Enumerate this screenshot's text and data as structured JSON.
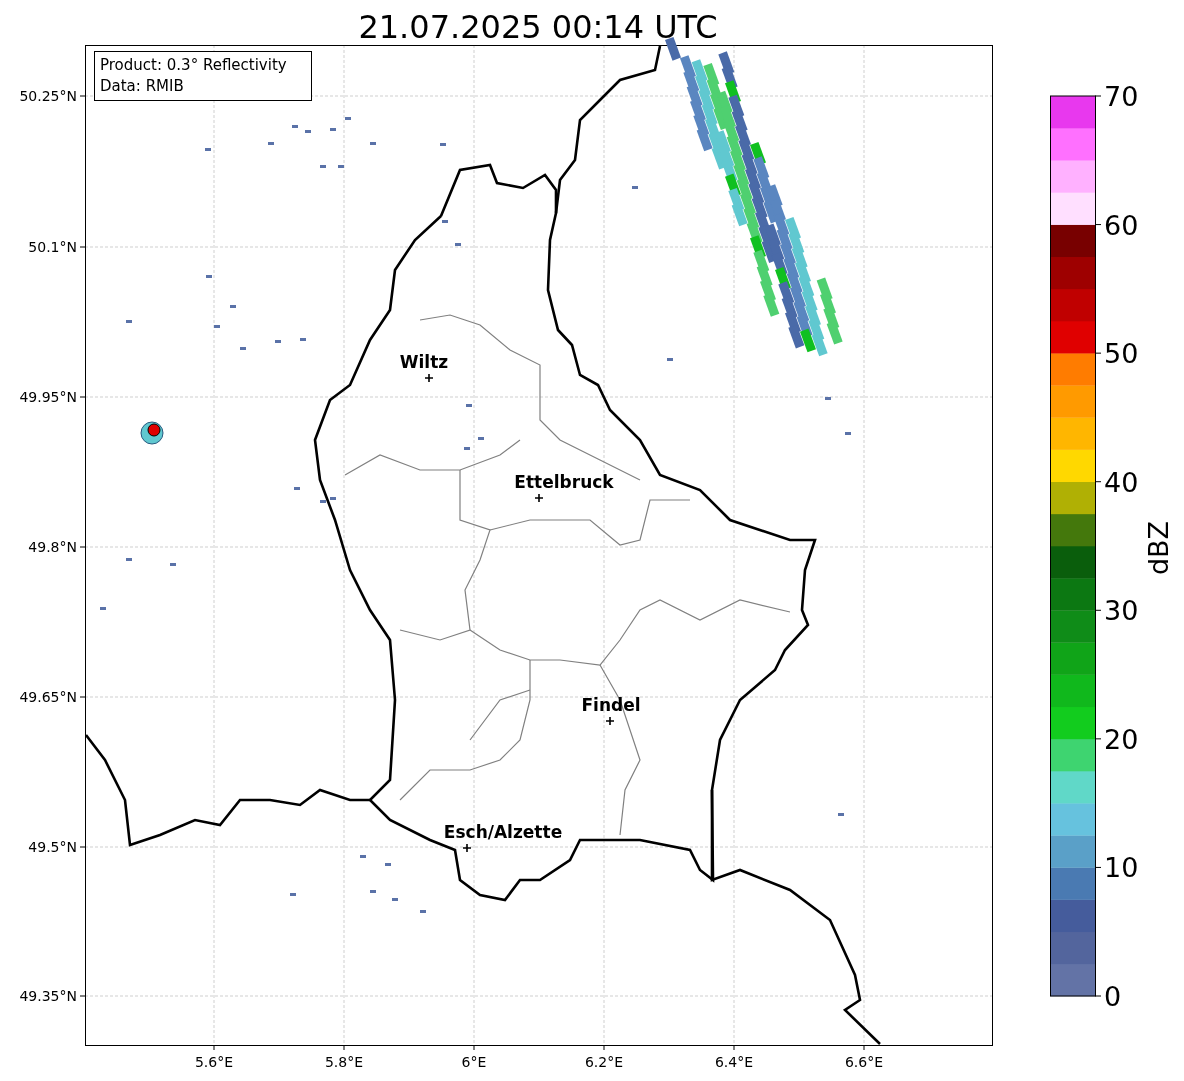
{
  "title": "21.07.2025 00:14 UTC",
  "info_box": {
    "lines": [
      "Product: 0.3° Reflectivity",
      "Data: RMIB"
    ]
  },
  "map": {
    "lat_ticks": [
      "50.25°N",
      "50.1°N",
      "49.95°N",
      "49.8°N",
      "49.65°N",
      "49.5°N",
      "49.35°N"
    ],
    "lon_ticks": [
      "5.6°E",
      "5.8°E",
      "6°E",
      "6.2°E",
      "6.4°E",
      "6.6°E"
    ],
    "cities": [
      {
        "name": "Wiltz"
      },
      {
        "name": "Ettelbruck"
      },
      {
        "name": "Findel"
      },
      {
        "name": "Esch/Alzette"
      }
    ]
  },
  "colorbar": {
    "label": "dBZ",
    "ticks": [
      "70",
      "60",
      "50",
      "40",
      "30",
      "20",
      "10",
      "0"
    ],
    "bins": [
      {
        "color": "#6373a6"
      },
      {
        "color": "#53659d"
      },
      {
        "color": "#455c9c"
      },
      {
        "color": "#4a7ab2"
      },
      {
        "color": "#5aa0c8"
      },
      {
        "color": "#66c2de"
      },
      {
        "color": "#60d8c8"
      },
      {
        "color": "#3ed470"
      },
      {
        "color": "#12cc1e"
      },
      {
        "color": "#10b81c"
      },
      {
        "color": "#10a418"
      },
      {
        "color": "#0f8c18"
      },
      {
        "color": "#0c7812"
      },
      {
        "color": "#0a5e0c"
      },
      {
        "color": "#44780c"
      },
      {
        "color": "#b0b004"
      },
      {
        "color": "#ffd800"
      },
      {
        "color": "#ffb600"
      },
      {
        "color": "#ff9a00"
      },
      {
        "color": "#ff7c00"
      },
      {
        "color": "#e00000"
      },
      {
        "color": "#c00000"
      },
      {
        "color": "#9e0000"
      },
      {
        "color": "#780000"
      },
      {
        "color": "#ffdfff"
      },
      {
        "color": "#ffb1ff"
      },
      {
        "color": "#ff70ff"
      },
      {
        "color": "#e838ee"
      }
    ]
  }
}
